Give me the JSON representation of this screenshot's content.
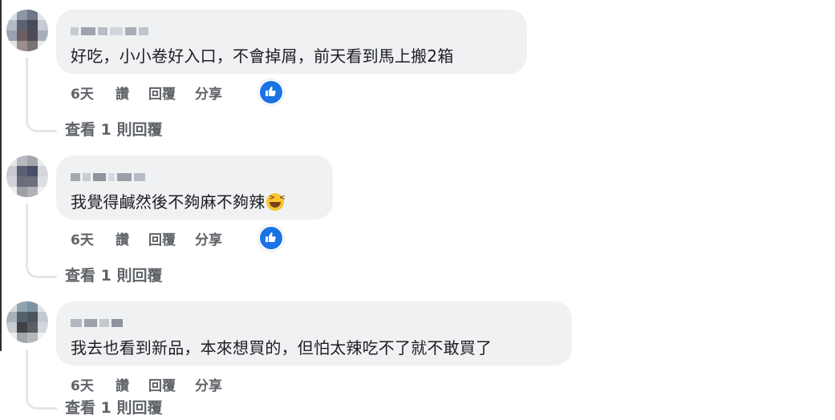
{
  "comments": [
    {
      "text": "好吃，小小卷好入口，不會掉屑，前天看到馬上搬2箱",
      "time": "6天",
      "like_label": "讚",
      "reply_label": "回覆",
      "share_label": "分享",
      "view_replies": "查看 1 則回覆",
      "has_reaction": true
    },
    {
      "text": "我覺得鹹然後不夠麻不夠辣",
      "emoji": "laughing-squint-emoji",
      "time": "6天",
      "like_label": "讚",
      "reply_label": "回覆",
      "share_label": "分享",
      "view_replies": "查看 1 則回覆",
      "has_reaction": true
    },
    {
      "text": "我去也看到新品，本來想買的，但怕太辣吃不了就不敢買了",
      "time": "6天",
      "like_label": "讚",
      "reply_label": "回覆",
      "share_label": "分享",
      "view_replies": "查看 1 則回覆",
      "has_reaction": false
    }
  ],
  "colors": {
    "bubble": "#eff1f3",
    "meta_text": "#5f6368",
    "like_blue": "#1b74e4"
  },
  "icons": {
    "reaction": "thumbs-up-icon"
  }
}
